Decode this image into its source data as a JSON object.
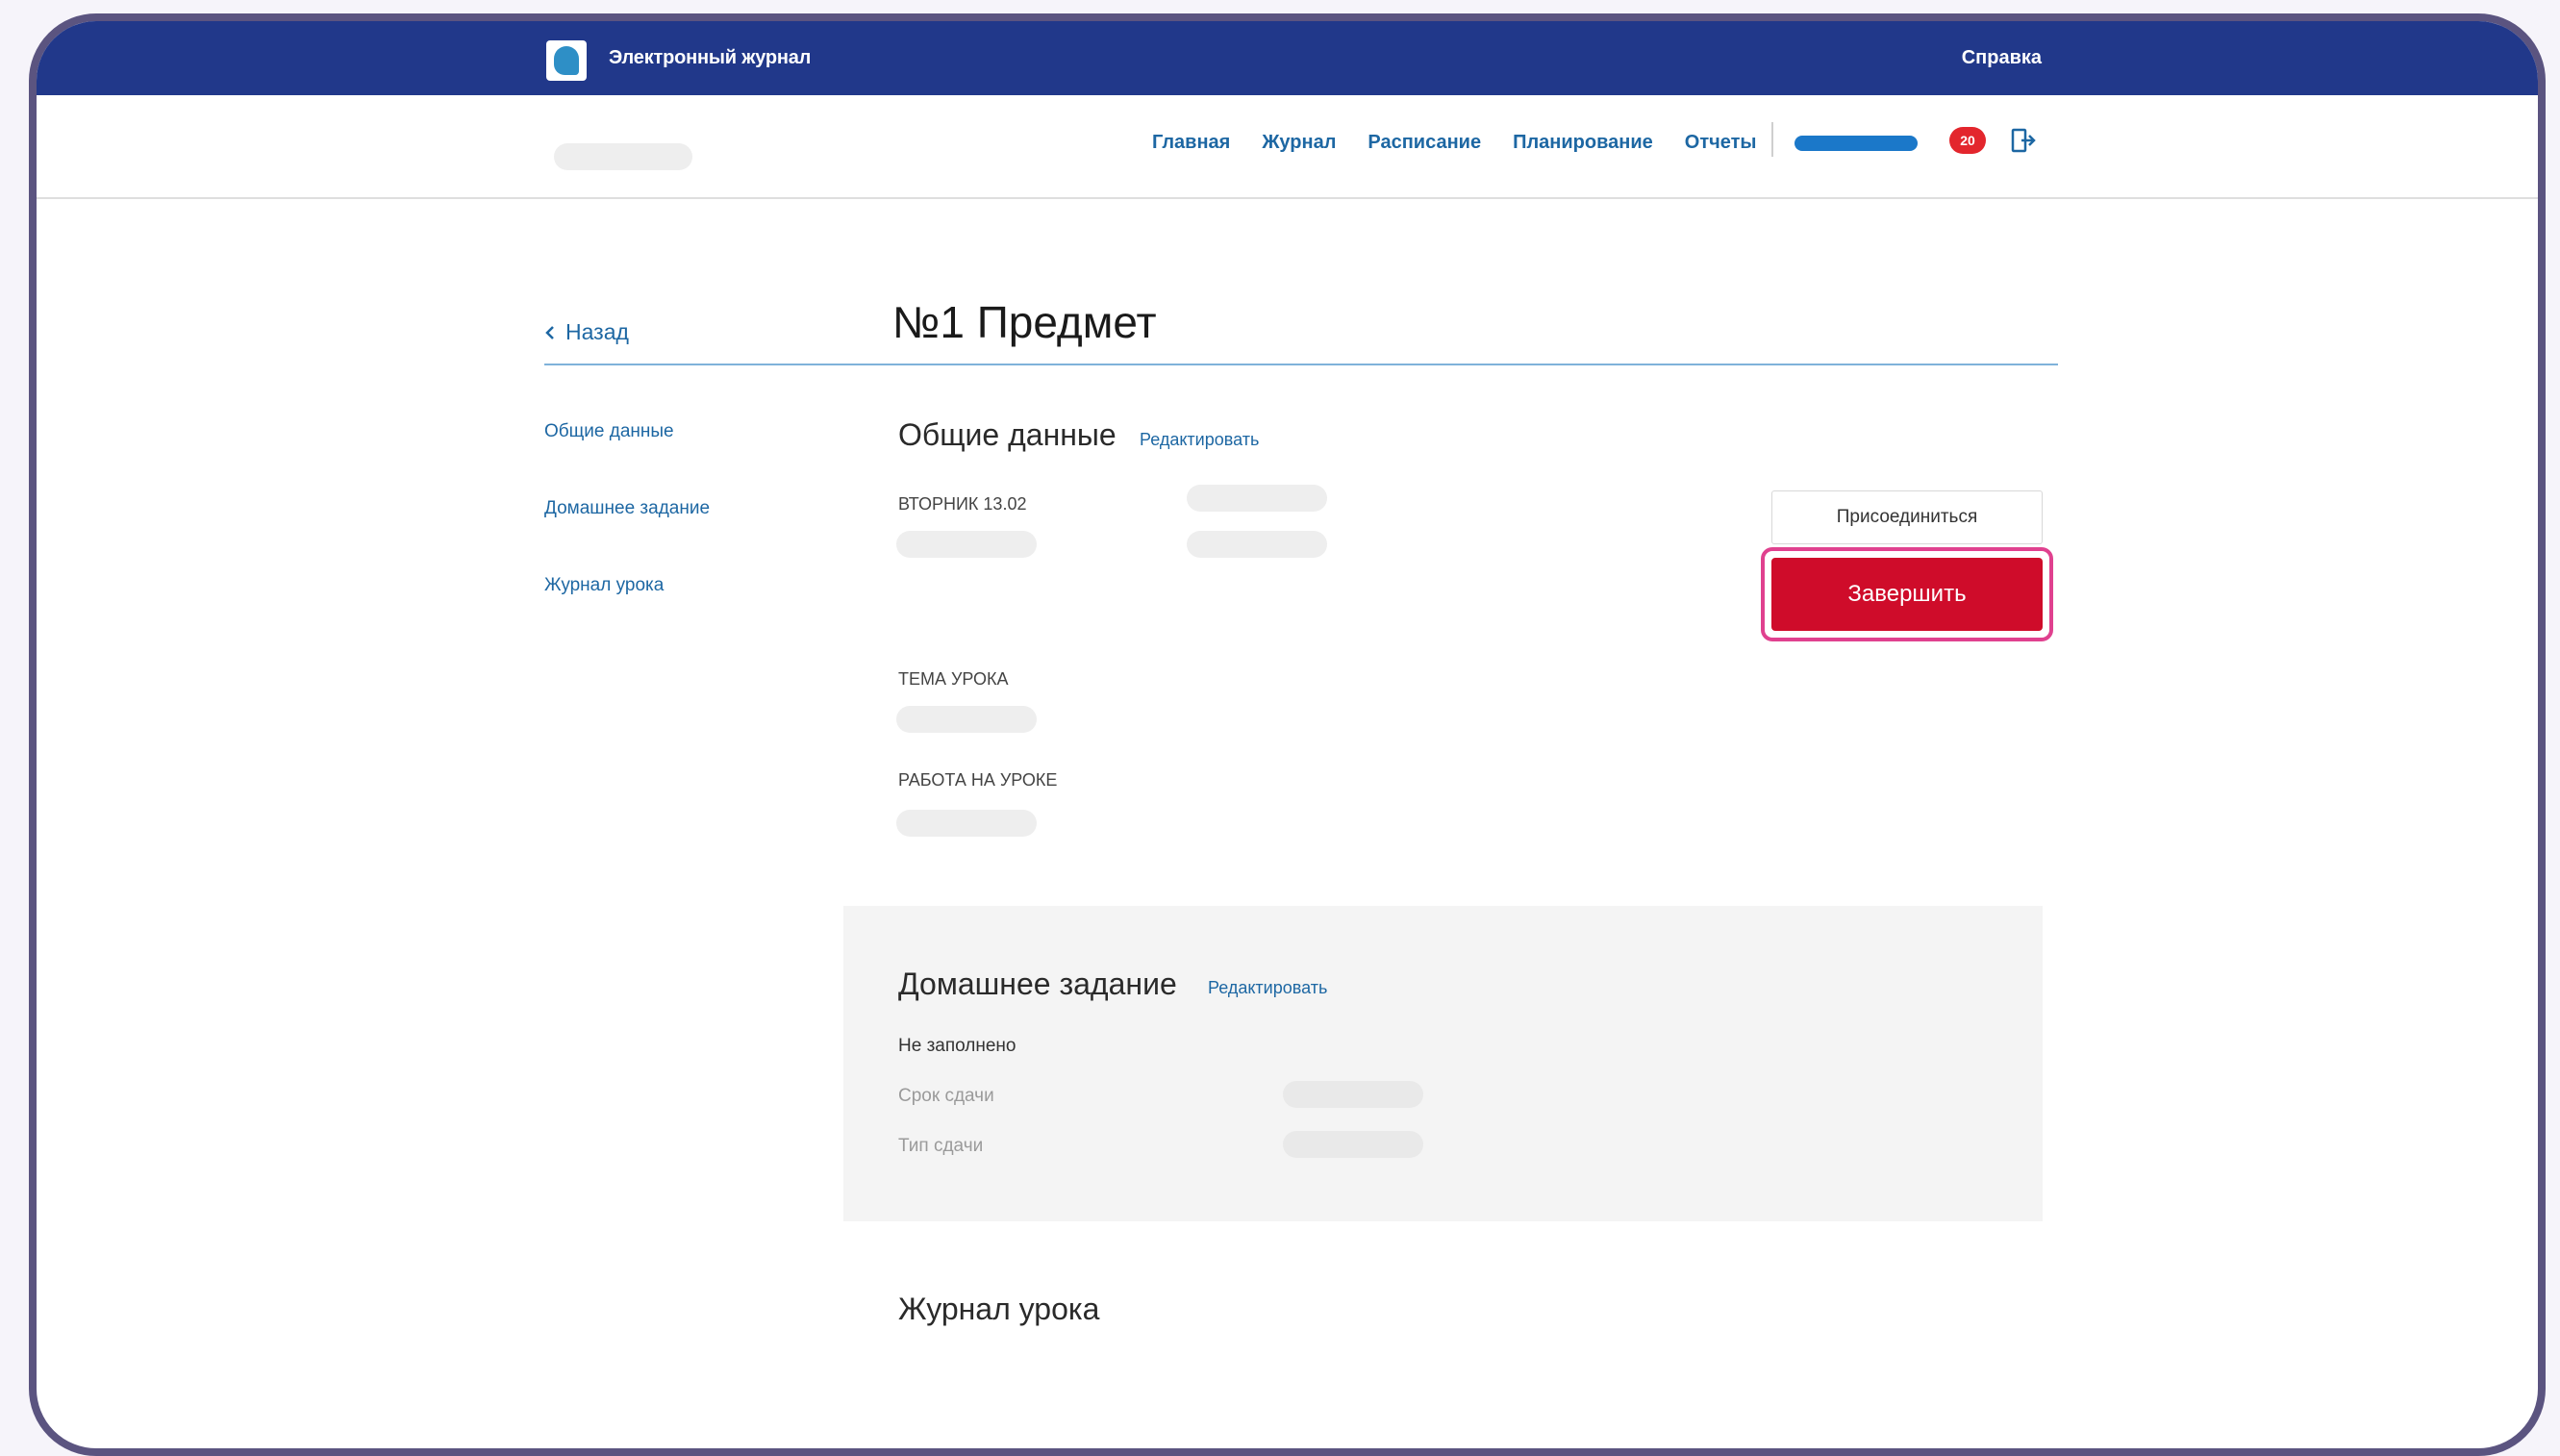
{
  "header": {
    "app_title": "Электронный журнал",
    "help_label": "Справка",
    "logo_icon": "journal-logo-icon",
    "background": "#21388a"
  },
  "nav": {
    "items": [
      {
        "label": "Главная"
      },
      {
        "label": "Журнал"
      },
      {
        "label": "Расписание"
      },
      {
        "label": "Планирование"
      },
      {
        "label": "Отчеты"
      }
    ],
    "notifications_count": "20",
    "logout_icon": "logout-icon",
    "link_color": "#1d67a3"
  },
  "page": {
    "back_label": "Назад",
    "title": "№1 Предмет"
  },
  "sidebar": {
    "items": [
      {
        "label": "Общие данные"
      },
      {
        "label": "Домашнее задание"
      },
      {
        "label": "Журнал урока"
      }
    ]
  },
  "general": {
    "title": "Общие данные",
    "edit_label": "Редактировать",
    "date_label": "ВТОРНИК 13.02",
    "topic_label": "ТЕМА УРОКА",
    "work_label": "РАБОТА НА УРОКЕ",
    "join_label": "Присоединиться",
    "finish_label": "Завершить",
    "finish_color": "#cf0c2a",
    "highlight_color": "#e0418f"
  },
  "homework": {
    "title": "Домашнее задание",
    "edit_label": "Редактировать",
    "status": "Не заполнено",
    "deadline_label": "Срок сдачи",
    "type_label": "Тип сдачи"
  },
  "lesson_log": {
    "title": "Журнал урока"
  }
}
